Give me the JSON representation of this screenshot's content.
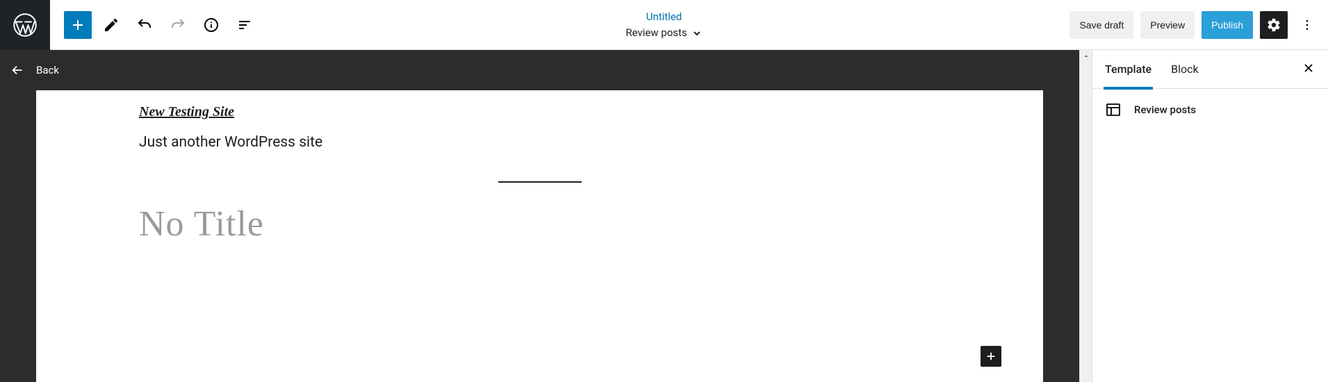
{
  "header": {
    "doc_title": "Untitled",
    "doc_subtitle": "Review posts",
    "buttons": {
      "save_draft": "Save draft",
      "preview": "Preview",
      "publish": "Publish"
    }
  },
  "editor": {
    "back_label": "Back",
    "site_title": "New Testing Site",
    "site_tagline": "Just another WordPress site",
    "post_title_placeholder": "No Title"
  },
  "sidebar": {
    "tabs": {
      "template": "Template",
      "block": "Block"
    },
    "template_name": "Review posts"
  }
}
